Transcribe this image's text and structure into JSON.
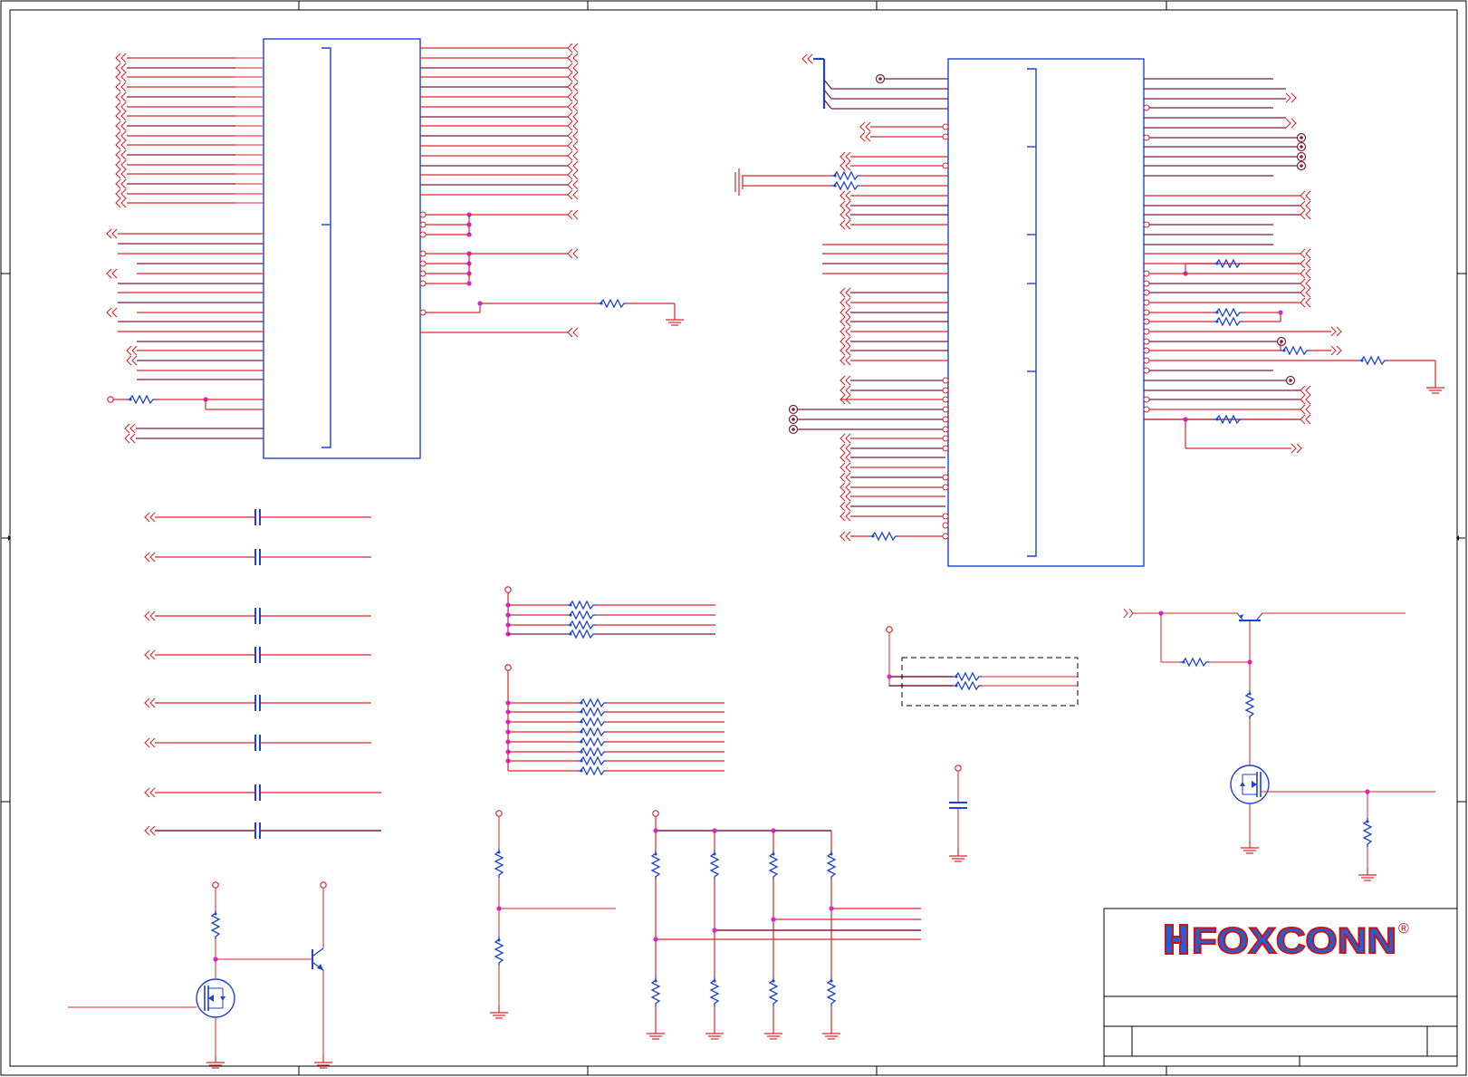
{
  "document": {
    "kind": "schematic-sheet",
    "colors": {
      "wire": "#d9262b",
      "bus": "#7a1f3a",
      "component": "#1f3fd6",
      "junction": "#e020d8",
      "frame": "#000000"
    },
    "icons": [
      "offpage-connector-icon",
      "resistor-icon",
      "capacitor-icon",
      "ground-icon",
      "power-rail-icon",
      "mosfet-icon",
      "npn-transistor-icon",
      "test-point-icon"
    ]
  },
  "title_block": {
    "company_logo": "FOXCONN",
    "registered_mark": "®"
  }
}
